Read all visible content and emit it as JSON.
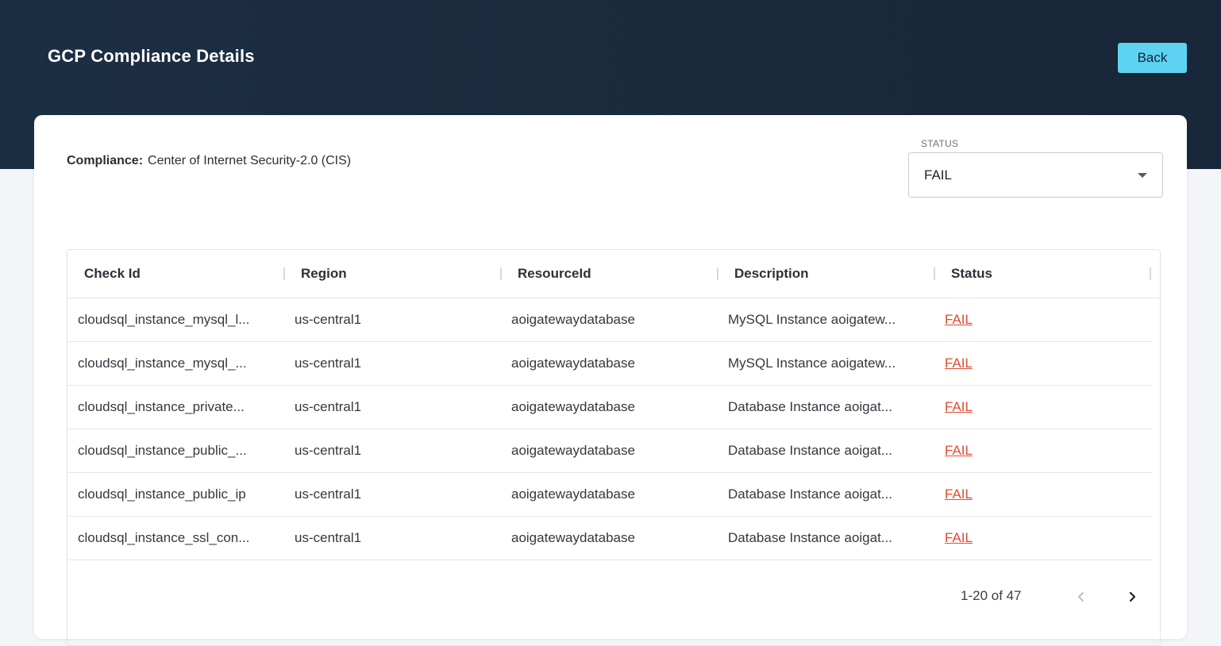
{
  "header": {
    "title": "GCP Compliance Details",
    "back_label": "Back"
  },
  "compliance": {
    "label": "Compliance:",
    "value": "Center of Internet Security-2.0 (CIS)"
  },
  "status_filter": {
    "legend": "STATUS",
    "value": "FAIL"
  },
  "table": {
    "columns": [
      "Check Id",
      "Region",
      "ResourceId",
      "Description",
      "Status"
    ],
    "rows": [
      {
        "check_id": "cloudsql_instance_mysql_l...",
        "region": "us-central1",
        "resource_id": "aoigatewaydatabase",
        "description": "MySQL Instance aoigatew...",
        "status": "FAIL"
      },
      {
        "check_id": "cloudsql_instance_mysql_...",
        "region": "us-central1",
        "resource_id": "aoigatewaydatabase",
        "description": "MySQL Instance aoigatew...",
        "status": "FAIL"
      },
      {
        "check_id": "cloudsql_instance_private...",
        "region": "us-central1",
        "resource_id": "aoigatewaydatabase",
        "description": "Database Instance aoigat...",
        "status": "FAIL"
      },
      {
        "check_id": "cloudsql_instance_public_...",
        "region": "us-central1",
        "resource_id": "aoigatewaydatabase",
        "description": "Database Instance aoigat...",
        "status": "FAIL"
      },
      {
        "check_id": "cloudsql_instance_public_ip",
        "region": "us-central1",
        "resource_id": "aoigatewaydatabase",
        "description": "Database Instance aoigat...",
        "status": "FAIL"
      },
      {
        "check_id": "cloudsql_instance_ssl_con...",
        "region": "us-central1",
        "resource_id": "aoigatewaydatabase",
        "description": "Database Instance aoigat...",
        "status": "FAIL"
      }
    ]
  },
  "pagination": {
    "info": "1-20 of 47",
    "prev_icon": "chevron-left-icon",
    "next_icon": "chevron-right-icon"
  },
  "colors": {
    "header_bg": "#1c2e44",
    "accent": "#5dd3f1",
    "fail": "#e04a2f"
  }
}
